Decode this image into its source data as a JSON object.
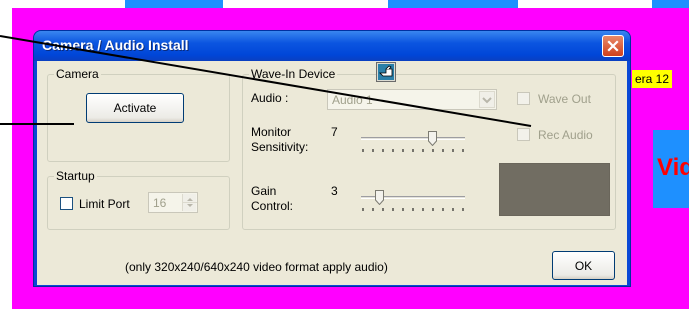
{
  "background": {
    "colors": {
      "surface": "#ff00ff",
      "tile": "#1e90ff",
      "label_bg": "#ffff00",
      "video_text": "#ff0000"
    },
    "camera_label": "era 12",
    "video_tile_text": "Vid"
  },
  "dialog": {
    "title": "Camera / Audio Install",
    "close_icon": "close-icon",
    "camera_group": {
      "title": "Camera",
      "activate_label": "Activate"
    },
    "startup_group": {
      "title": "Startup",
      "limit_port_label": "Limit Port",
      "limit_port_checked": false,
      "port_value": "16"
    },
    "wavein_group": {
      "title": "Wave-In Device",
      "device_icon": "hand-pointer-icon",
      "audio_label": "Audio :",
      "audio_selected": "Audio 1",
      "wave_out_label": "Wave Out",
      "rec_audio_label": "Rec Audio",
      "monitor_label_line1": "Monitor",
      "monitor_label_line2": "Sensitivity:",
      "monitor_value": "7",
      "monitor_level": 0.7,
      "gain_label_line1": "Gain",
      "gain_label_line2": "Control:",
      "gain_value": "3",
      "gain_level": 0.15
    },
    "footer_note": "(only 320x240/640x240 video format apply audio)",
    "ok_label": "OK"
  }
}
